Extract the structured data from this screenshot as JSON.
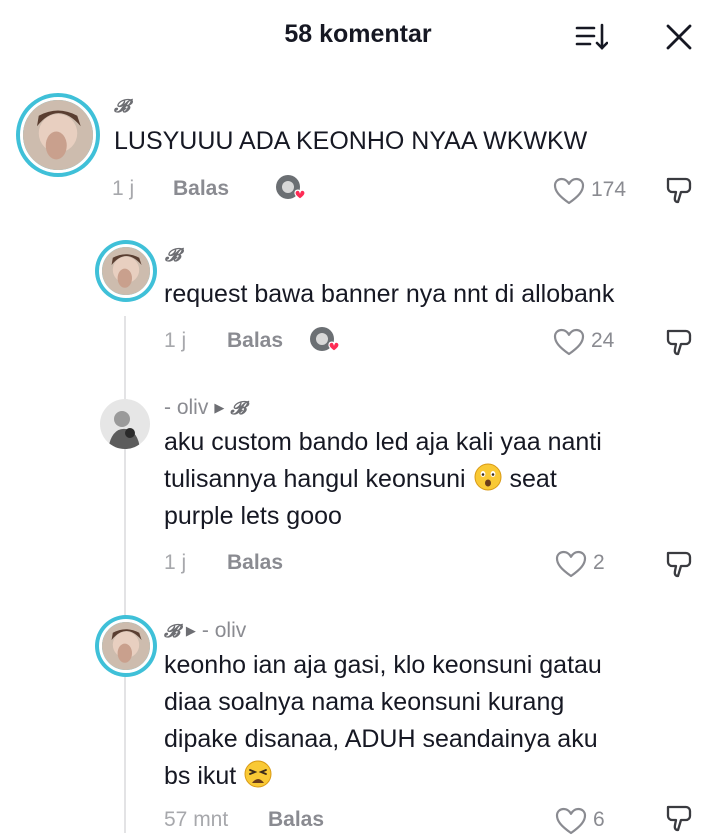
{
  "header": {
    "title": "58 komentar"
  },
  "comments": [
    {
      "username": "𝓑",
      "text": "LUSYUUU ADA KEONHO NYAA WKWKW",
      "time": "1 j",
      "reply_label": "Balas",
      "likes": "174"
    },
    {
      "username": "𝓑",
      "text": "request bawa banner nya nnt di allobank",
      "time": "1 j",
      "reply_label": "Balas",
      "likes": "24"
    },
    {
      "username": "- oliv",
      "reply_to": "𝓑",
      "text_lines": [
        "aku custom bando led aja kali yaa nanti",
        "tulisannya hangul keonsuni",
        "seat",
        "purple lets gooo"
      ],
      "time": "1 j",
      "reply_label": "Balas",
      "likes": "2"
    },
    {
      "username": "𝓑",
      "reply_to": "- oliv",
      "text_lines": [
        "keonho ian aja gasi, klo keonsuni gatau",
        "diaa soalnya nama keonsuni kurang",
        "dipake disanaa, ADUH seandainya aku",
        "bs ikut"
      ],
      "time": "57 mnt",
      "reply_label": "Balas",
      "likes": "6"
    }
  ],
  "icons": {
    "sort": "sort-icon",
    "close": "close-icon",
    "heart": "heart-outline-icon",
    "dislike": "dislike-icon",
    "creator_liked": "creator-liked-avatar-icon",
    "emoji_1": "face-with-open-mouth-emoji",
    "emoji_2": "weary-face-emoji"
  },
  "colors": {
    "ring": "#3fc0d8",
    "liked_heart": "#fe2c55"
  }
}
